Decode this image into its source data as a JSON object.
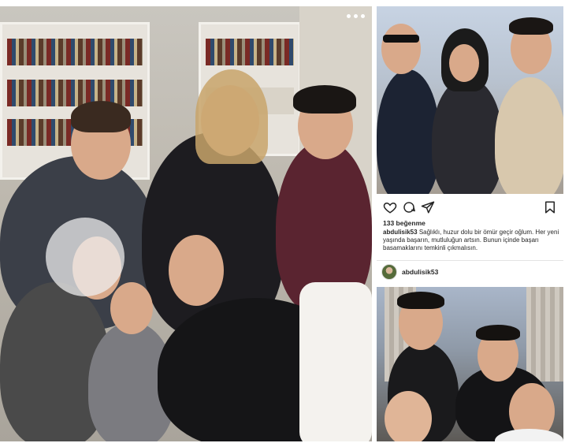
{
  "left_photo": {
    "more_menu_label": "More options"
  },
  "post": {
    "likes": "133 beğenme",
    "caption_username": "abdulisik53",
    "caption_text": "Sağlıklı, huzur dolu bir ömür geçir oğlum. Her yeni yaşında başarın, mutluluğun artsın. Bunun içinde başarı basamaklarını temkinli çıkmalısın."
  },
  "comment": {
    "username": "abdulisik53"
  },
  "icons": {
    "like": "heart-icon",
    "comment": "comment-icon",
    "share": "send-icon",
    "save": "bookmark-icon",
    "more": "more-horizontal-icon"
  },
  "colors": {
    "text": "#262626",
    "divider": "#e3e3e3",
    "background": "#ffffff"
  }
}
